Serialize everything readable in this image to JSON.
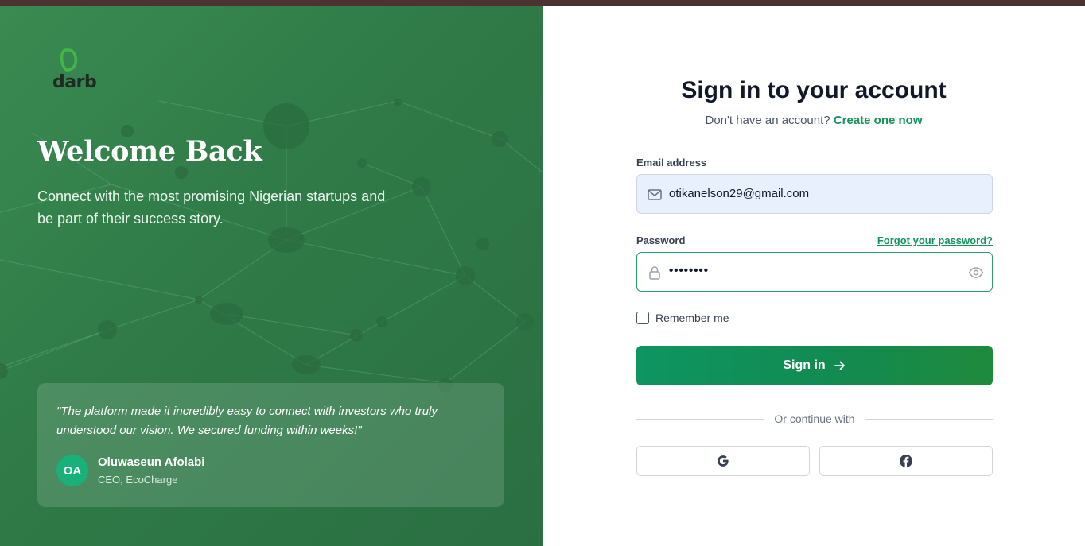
{
  "brand": {
    "name": "darb"
  },
  "hero": {
    "title": "Welcome Back",
    "tagline": "Connect with the most promising Nigerian startups and be part of their success story."
  },
  "testimonial": {
    "quote": "\"The platform made it incredibly easy to connect with investors who truly understood our vision. We secured funding within weeks!\"",
    "initials": "OA",
    "name": "Oluwaseun Afolabi",
    "role": "CEO, EcoCharge"
  },
  "form": {
    "title": "Sign in to your account",
    "subtitle_prefix": "Don't have an account?",
    "create_link": "Create one now",
    "email_label": "Email address",
    "email_value": "otikanelson29@gmail.com",
    "password_label": "Password",
    "forgot_link": "Forgot your password?",
    "password_value": "••••••••",
    "remember_label": "Remember me",
    "submit_label": "Sign in",
    "divider_text": "Or continue with"
  },
  "social": [
    {
      "icon": "google-icon"
    },
    {
      "icon": "facebook-icon"
    }
  ],
  "colors": {
    "brand_green": "#15935c",
    "panel_green": "#2f7a47",
    "button_green": "#0e9561",
    "input_autofill": "#e8f0fe"
  }
}
